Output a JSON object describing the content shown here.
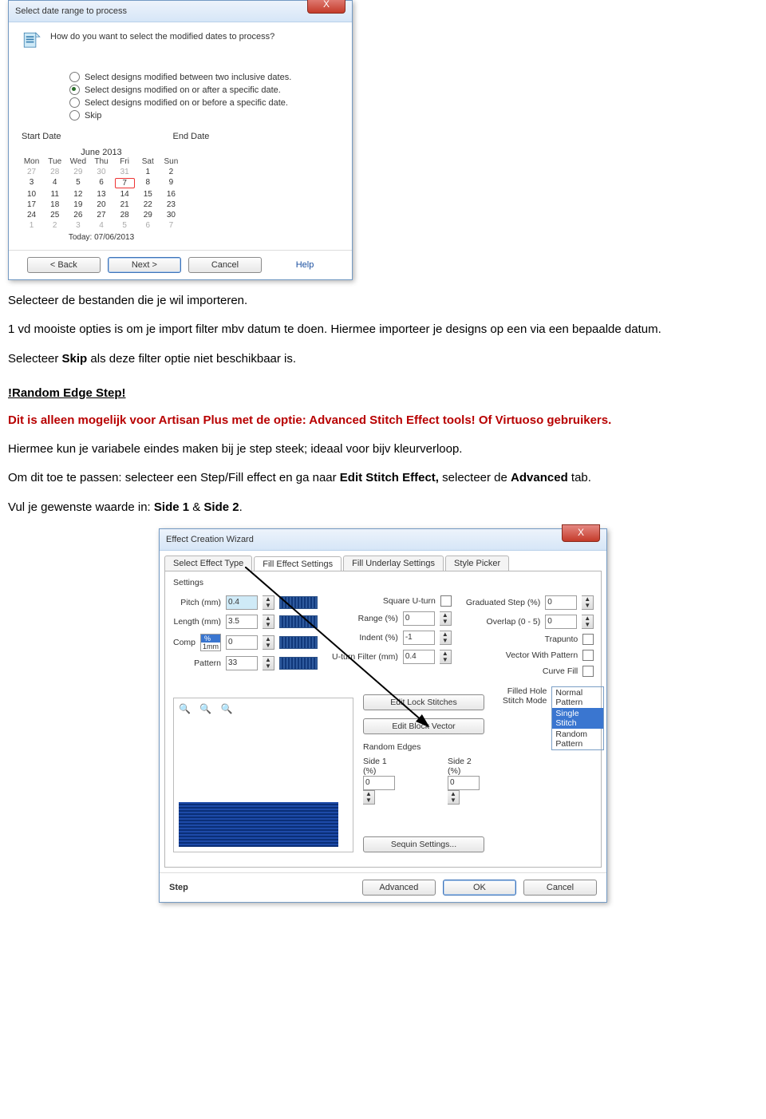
{
  "dlg1": {
    "title": "Select date range to process",
    "close": "X",
    "question": "How do you want to select the modified dates to process?",
    "opts": [
      "Select designs modified between two inclusive dates.",
      "Select designs modified on or after a specific date.",
      "Select designs modified on or before a specific date.",
      "Skip"
    ],
    "start_label": "Start Date",
    "end_label": "End Date",
    "cal_month": "June 2013",
    "dow": [
      "Mon",
      "Tue",
      "Wed",
      "Thu",
      "Fri",
      "Sat",
      "Sun"
    ],
    "days_dim_pre": [
      "27",
      "28",
      "29",
      "30",
      "31"
    ],
    "days": [
      "1",
      "2",
      "3",
      "4",
      "5",
      "6",
      "7",
      "8",
      "9",
      "10",
      "11",
      "12",
      "13",
      "14",
      "15",
      "16",
      "17",
      "18",
      "19",
      "20",
      "21",
      "22",
      "23",
      "24",
      "25",
      "26",
      "27",
      "28",
      "29",
      "30"
    ],
    "days_dim_post": [
      "1",
      "2",
      "3",
      "4",
      "5",
      "6",
      "7"
    ],
    "today_index": 6,
    "today_label": "Today: 07/06/2013",
    "buttons": {
      "back": "< Back",
      "next": "Next >",
      "cancel": "Cancel",
      "help": "Help"
    }
  },
  "body": {
    "p1": "Selecteer de bestanden die je wil importeren.",
    "p2a": "1 vd mooiste opties is om je import filter mbv datum te doen. Hiermee importeer je designs op een via een bepaalde datum.",
    "p3a": "Selecteer ",
    "p3b": "Skip",
    "p3c": " als deze filter optie niet beschikbaar is.",
    "h2": "!Random Edge Step!",
    "red": "Dit is alleen mogelijk voor Artisan Plus met de optie: Advanced Stitch Effect tools! Of Virtuoso gebruikers.",
    "p4": "Hiermee kun je variabele eindes maken bij je step steek; ideaal voor bijv kleurverloop.",
    "p5a": "Om dit toe te passen: selecteer een Step/Fill effect en ga naar ",
    "p5b": "Edit Stitch Effect,",
    "p5c": " selecteer de ",
    "p5d": "Advanced",
    "p5e": " tab.",
    "p6a": "Vul je gewenste waarde in: ",
    "p6b": "Side 1",
    "p6c": " & ",
    "p6d": "Side 2",
    "p6e": "."
  },
  "dlg2": {
    "title": "Effect Creation Wizard",
    "close": "X",
    "tabs": [
      "Select Effect Type",
      "Fill Effect Settings",
      "Fill Underlay Settings",
      "Style Picker"
    ],
    "settings_label": "Settings",
    "fields_left": {
      "pitch": "Pitch (mm)",
      "pitch_v": "0.4",
      "length": "Length (mm)",
      "length_v": "3.5",
      "comp": "Comp",
      "comp_v": "0",
      "comp_unit_a": "%",
      "comp_unit_b": "1mm",
      "pattern": "Pattern",
      "pattern_v": "33"
    },
    "fields_mid": {
      "square": "Square U-turn",
      "range": "Range (%)",
      "range_v": "0",
      "indent": "Indent (%)",
      "indent_v": "-1",
      "ufilter": "U-turn Filter (mm)",
      "ufilter_v": "0.4",
      "edit_lock": "Edit Lock Stitches",
      "edit_block": "Edit Block Vector"
    },
    "fields_right": {
      "grad": "Graduated Step (%)",
      "grad_v": "0",
      "overlap": "Overlap (0 - 5)",
      "overlap_v": "0",
      "trapunto": "Trapunto",
      "vec": "Vector With Pattern",
      "curve": "Curve Fill",
      "fhsm": "Filled Hole Stitch Mode",
      "fhsm_opts": [
        "Normal Pattern",
        "Single Stitch",
        "Random Pattern"
      ]
    },
    "random_label": "Random Edges",
    "side1": "Side 1 (%)",
    "side1_v": "0",
    "side2": "Side 2 (%)",
    "side2_v": "0",
    "sequin": "Sequin Settings...",
    "effect_name": "Step",
    "buttons": {
      "adv": "Advanced",
      "ok": "OK",
      "cancel": "Cancel"
    }
  }
}
